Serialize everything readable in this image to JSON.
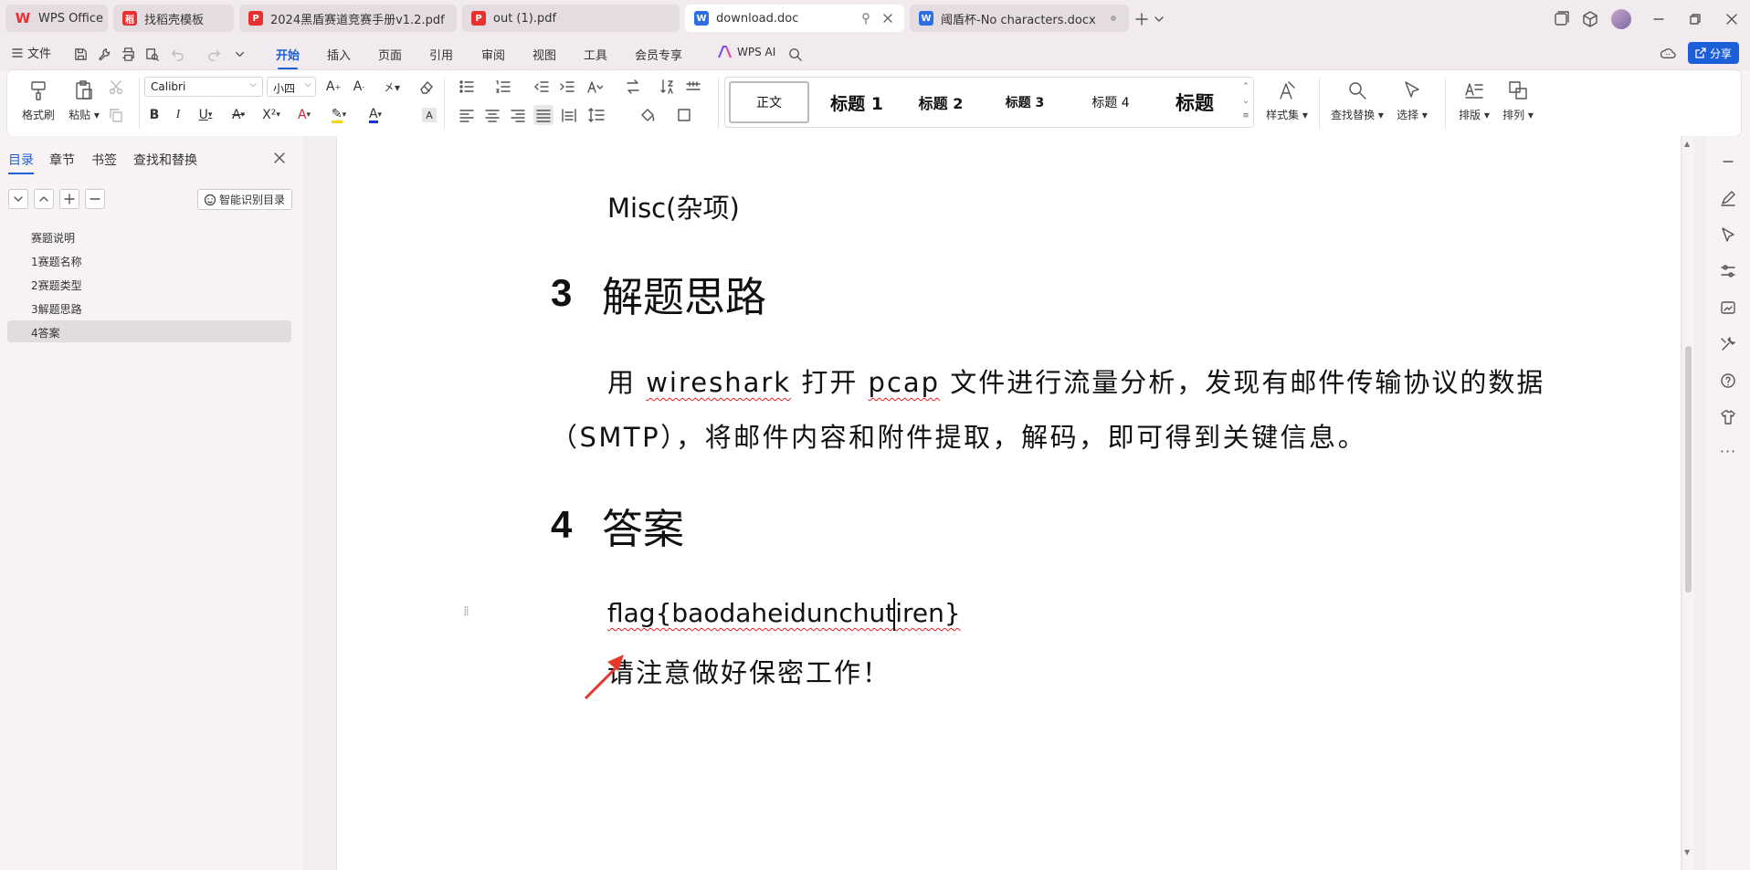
{
  "tabs": [
    {
      "label": "WPS Office"
    },
    {
      "label": "找稻壳模板"
    },
    {
      "label": "2024黑盾赛道竞赛手册v1.2.pdf"
    },
    {
      "label": "out (1).pdf"
    },
    {
      "label": "download.doc"
    },
    {
      "label": "阈盾杯-No characters.docx"
    }
  ],
  "menu": {
    "file": "文件",
    "tabs": [
      "开始",
      "插入",
      "页面",
      "引用",
      "审阅",
      "视图",
      "工具",
      "会员专享"
    ],
    "wps_ai": "WPS AI",
    "share": "分享"
  },
  "ribbon": {
    "format_painter": "格式刷",
    "paste": "粘贴",
    "font_name": "Calibri",
    "font_size": "小四",
    "styles": [
      "正文",
      "标题 1",
      "标题 2",
      "标题 3",
      "标题 4",
      "标题"
    ],
    "style_set": "样式集",
    "find_replace": "查找替换",
    "select": "选择",
    "layout": "排版",
    "arrange": "排列"
  },
  "nav": {
    "tabs": [
      "目录",
      "章节",
      "书签",
      "查找和替换"
    ],
    "smart_toc": "智能识别目录",
    "items": [
      "赛题说明",
      "1赛题名称",
      "2赛题类型",
      "3解题思路",
      "4答案"
    ],
    "selected_index": 4
  },
  "doc": {
    "misc_line": "Misc(杂项)",
    "h3_num": "3",
    "h3_text": "解题思路",
    "p1_a": "用 ",
    "p1_wireshark": "wireshark",
    "p1_b": " 打开 ",
    "p1_pcap": "pcap",
    "p1_c": " 文件进行流量分析，发现有邮件传输协议的数据",
    "p2": "（SMTP），将邮件内容和附件提取，解码，即可得到关键信息。",
    "h4_num": "4",
    "h4_text": "答案",
    "flag": "flag{baodaheidunchutiren}",
    "note": "请注意做好保密工作！"
  },
  "colors": {
    "accent": "#1d5fd8",
    "wps_red": "#e8312f",
    "annotation_arrow": "#e33a2c"
  }
}
